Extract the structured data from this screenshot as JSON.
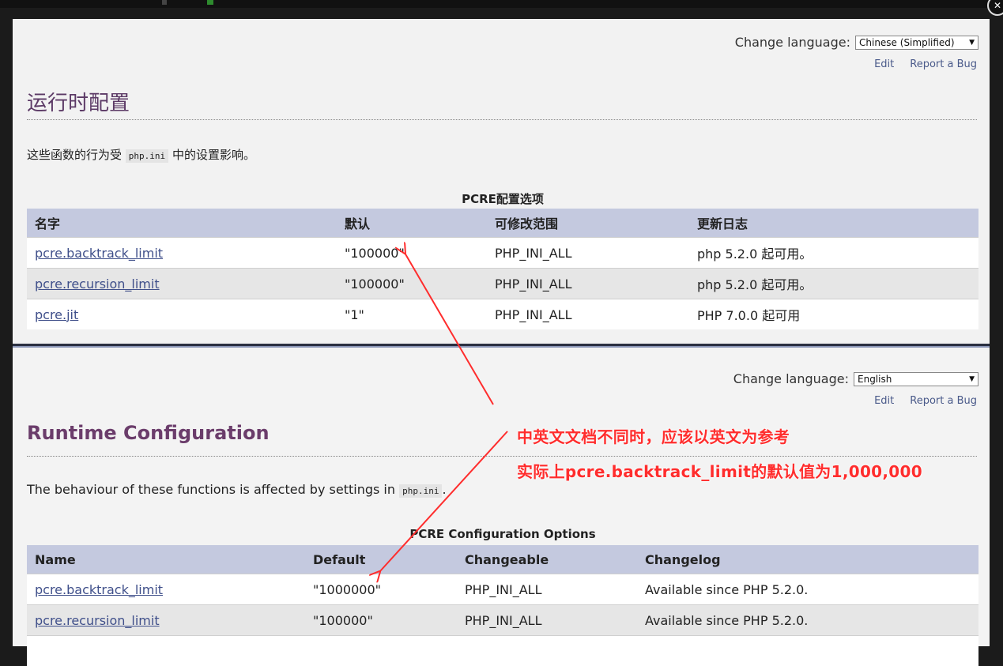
{
  "cn": {
    "lang_label": "Change language:",
    "lang_value": "Chinese (Simplified)",
    "edit": "Edit",
    "report": "Report a Bug",
    "title": "运行时配置",
    "para_before": "这些函数的行为受",
    "para_code": "php.ini",
    "para_after": "中的设置影响。",
    "caption": "PCRE配置选项",
    "headers": [
      "名字",
      "默认",
      "可修改范围",
      "更新日志"
    ],
    "rows": [
      [
        "pcre.backtrack_limit",
        "\"100000\"",
        "PHP_INI_ALL",
        "php 5.2.0 起可用。"
      ],
      [
        "pcre.recursion_limit",
        "\"100000\"",
        "PHP_INI_ALL",
        "php 5.2.0 起可用。"
      ],
      [
        "pcre.jit",
        "\"1\"",
        "PHP_INI_ALL",
        "PHP 7.0.0 起可用"
      ]
    ]
  },
  "en": {
    "lang_label": "Change language:",
    "lang_value": "English",
    "edit": "Edit",
    "report": "Report a Bug",
    "title": "Runtime Configuration",
    "para_before": "The behaviour of these functions is affected by settings in",
    "para_code": "php.ini",
    "para_after": ".",
    "caption": "PCRE Configuration Options",
    "headers": [
      "Name",
      "Default",
      "Changeable",
      "Changelog"
    ],
    "rows": [
      [
        "pcre.backtrack_limit",
        "\"1000000\"",
        "PHP_INI_ALL",
        "Available since PHP 5.2.0."
      ],
      [
        "pcre.recursion_limit",
        "\"100000\"",
        "PHP_INI_ALL",
        "Available since PHP 5.2.0."
      ]
    ]
  },
  "annotation": {
    "line1": "中英文文档不同时，应该以英文为参考",
    "line2": "实际上pcre.backtrack_limit的默认值为1,000,000",
    "color": "#ff2d2d"
  },
  "colors": {
    "header_bg": "#c4c9df",
    "link": "#3f4f8a",
    "title_purple": "#5c3a66"
  }
}
